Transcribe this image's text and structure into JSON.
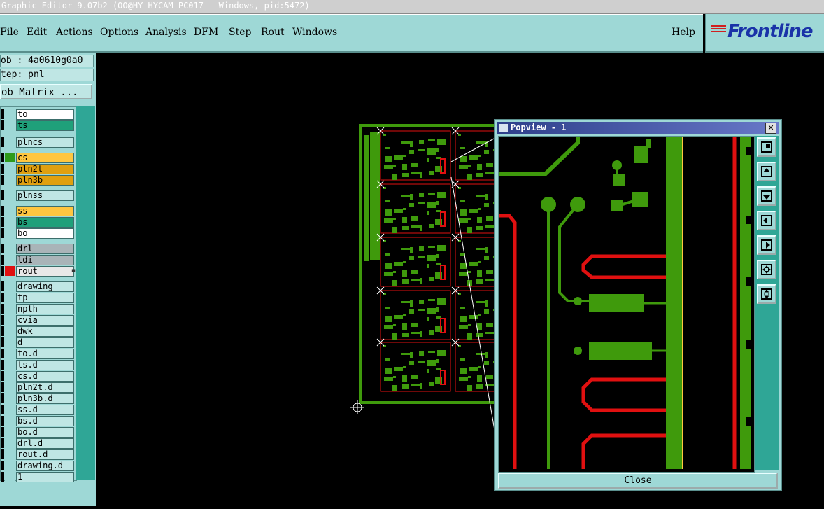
{
  "window": {
    "title": "Graphic Editor 9.07b2 (OO@HY-HYCAM-PC017 - Windows, pid:5472)"
  },
  "menu": {
    "items": [
      "File",
      "Edit",
      "Actions",
      "Options",
      "Analysis",
      "DFM",
      "Step",
      "Rout",
      "Windows"
    ],
    "help": "Help"
  },
  "logo": {
    "text": "Frontline"
  },
  "job": {
    "job": "ob : 4a0610g0a0",
    "step": "tep: pnl",
    "matrix_button": "ob Matrix ..."
  },
  "layers": [
    {
      "name": "to",
      "color": "#ffffff",
      "swatch": "#9ed8d6"
    },
    {
      "name": "ts",
      "color": "#1fa07a",
      "swatch": "#9ed8d6"
    },
    {
      "name": "plncs",
      "color": "#bfe6e4",
      "swatch": "#9ed8d6"
    },
    {
      "name": "cs",
      "color": "#ffc640",
      "swatch": "#2e9a1a"
    },
    {
      "name": "pln2t",
      "color": "#e0a010",
      "swatch": "#9ed8d6"
    },
    {
      "name": "pln3b",
      "color": "#e0a010",
      "swatch": "#9ed8d6"
    },
    {
      "name": "plnss",
      "color": "#bfe6e4",
      "swatch": "#9ed8d6"
    },
    {
      "name": "ss",
      "color": "#ffc640",
      "swatch": "#9ed8d6"
    },
    {
      "name": "bs",
      "color": "#1fa07a",
      "swatch": "#9ed8d6"
    },
    {
      "name": "bo",
      "color": "#ffffff",
      "swatch": "#9ed8d6"
    },
    {
      "name": "drl",
      "color": "#a9b4b8",
      "swatch": "#9ed8d6"
    },
    {
      "name": "ldi",
      "color": "#a9b4b8",
      "swatch": "#9ed8d6"
    },
    {
      "name": "rout",
      "color": "#e8e8e8",
      "swatch": "#e01010"
    },
    {
      "name": "drawing",
      "color": "#bfe6e4",
      "swatch": "#9ed8d6"
    },
    {
      "name": "tp",
      "color": "#bfe6e4",
      "swatch": "#9ed8d6"
    },
    {
      "name": "npth",
      "color": "#bfe6e4",
      "swatch": "#9ed8d6"
    },
    {
      "name": "cvia",
      "color": "#bfe6e4",
      "swatch": "#9ed8d6"
    },
    {
      "name": "dwk",
      "color": "#bfe6e4",
      "swatch": "#9ed8d6"
    },
    {
      "name": "d",
      "color": "#bfe6e4",
      "swatch": "#9ed8d6"
    },
    {
      "name": "to.d",
      "color": "#bfe6e4",
      "swatch": "#9ed8d6"
    },
    {
      "name": "ts.d",
      "color": "#bfe6e4",
      "swatch": "#9ed8d6"
    },
    {
      "name": "cs.d",
      "color": "#bfe6e4",
      "swatch": "#9ed8d6"
    },
    {
      "name": "pln2t.d",
      "color": "#bfe6e4",
      "swatch": "#9ed8d6"
    },
    {
      "name": "pln3b.d",
      "color": "#bfe6e4",
      "swatch": "#9ed8d6"
    },
    {
      "name": "ss.d",
      "color": "#bfe6e4",
      "swatch": "#9ed8d6"
    },
    {
      "name": "bs.d",
      "color": "#bfe6e4",
      "swatch": "#9ed8d6"
    },
    {
      "name": "bo.d",
      "color": "#bfe6e4",
      "swatch": "#9ed8d6"
    },
    {
      "name": "drl.d",
      "color": "#bfe6e4",
      "swatch": "#9ed8d6"
    },
    {
      "name": "rout.d",
      "color": "#bfe6e4",
      "swatch": "#9ed8d6"
    },
    {
      "name": "drawing.d",
      "color": "#bfe6e4",
      "swatch": "#9ed8d6"
    },
    {
      "name": "1",
      "color": "#bfe6e4",
      "swatch": "#9ed8d6"
    }
  ],
  "popview": {
    "title": "Popview - 1",
    "close_label": "Close",
    "tools": [
      "zoom-window-icon",
      "pan-up-icon",
      "pan-down-icon",
      "pan-left-icon",
      "pan-right-icon",
      "zoom-fit-icon",
      "zoom-in-out-icon"
    ]
  },
  "colors": {
    "panel": "#9ed8d6",
    "trace_green": "#3f9a0c",
    "rout_red": "#e01010",
    "title_blue": "#2d3f8a"
  }
}
